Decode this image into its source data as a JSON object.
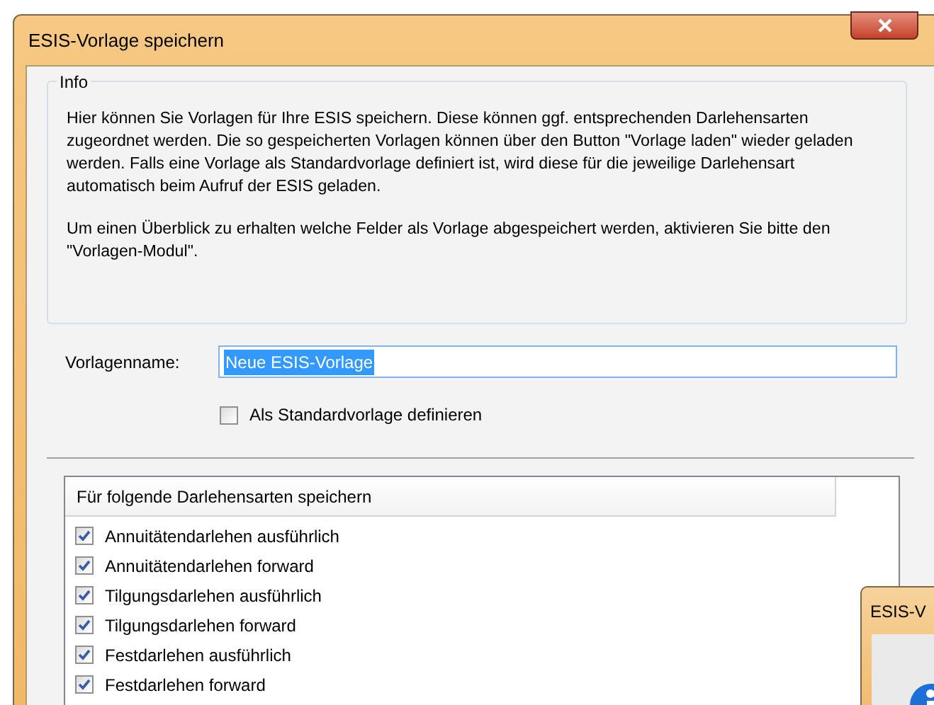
{
  "window": {
    "title": "ESIS-Vorlage speichern"
  },
  "info": {
    "title": "Info",
    "paragraphs": [
      "Hier können Sie Vorlagen für Ihre ESIS speichern. Diese können ggf. entsprechenden Darlehensarten zugeordnet werden. Die so gespeicherten Vorlagen können über den Button \"Vorlage laden\" wieder geladen werden. Falls eine Vorlage als Standardvorlage definiert ist, wird diese für die jeweilige Darlehensart automatisch beim Aufruf der ESIS geladen.",
      "Um einen Überblick zu erhalten welche Felder als Vorlage abgespeichert werden, aktivieren Sie bitte den \"Vorlagen-Modul\"."
    ]
  },
  "name_field": {
    "label": "Vorlagenname:",
    "value": "Neue ESIS-Vorlage"
  },
  "default_checkbox": {
    "label": "Als Standardvorlage definieren",
    "checked": false
  },
  "loan_list": {
    "header": "Für folgende Darlehensarten speichern",
    "items": [
      {
        "label": "Annuitätendarlehen ausführlich",
        "checked": true
      },
      {
        "label": "Annuitätendarlehen forward",
        "checked": true
      },
      {
        "label": "Tilgungsdarlehen ausführlich",
        "checked": true
      },
      {
        "label": "Tilgungsdarlehen forward",
        "checked": true
      },
      {
        "label": "Festdarlehen ausführlich",
        "checked": true
      },
      {
        "label": "Festdarlehen forward",
        "checked": true
      }
    ]
  },
  "second_window": {
    "title": "ESIS-V"
  }
}
